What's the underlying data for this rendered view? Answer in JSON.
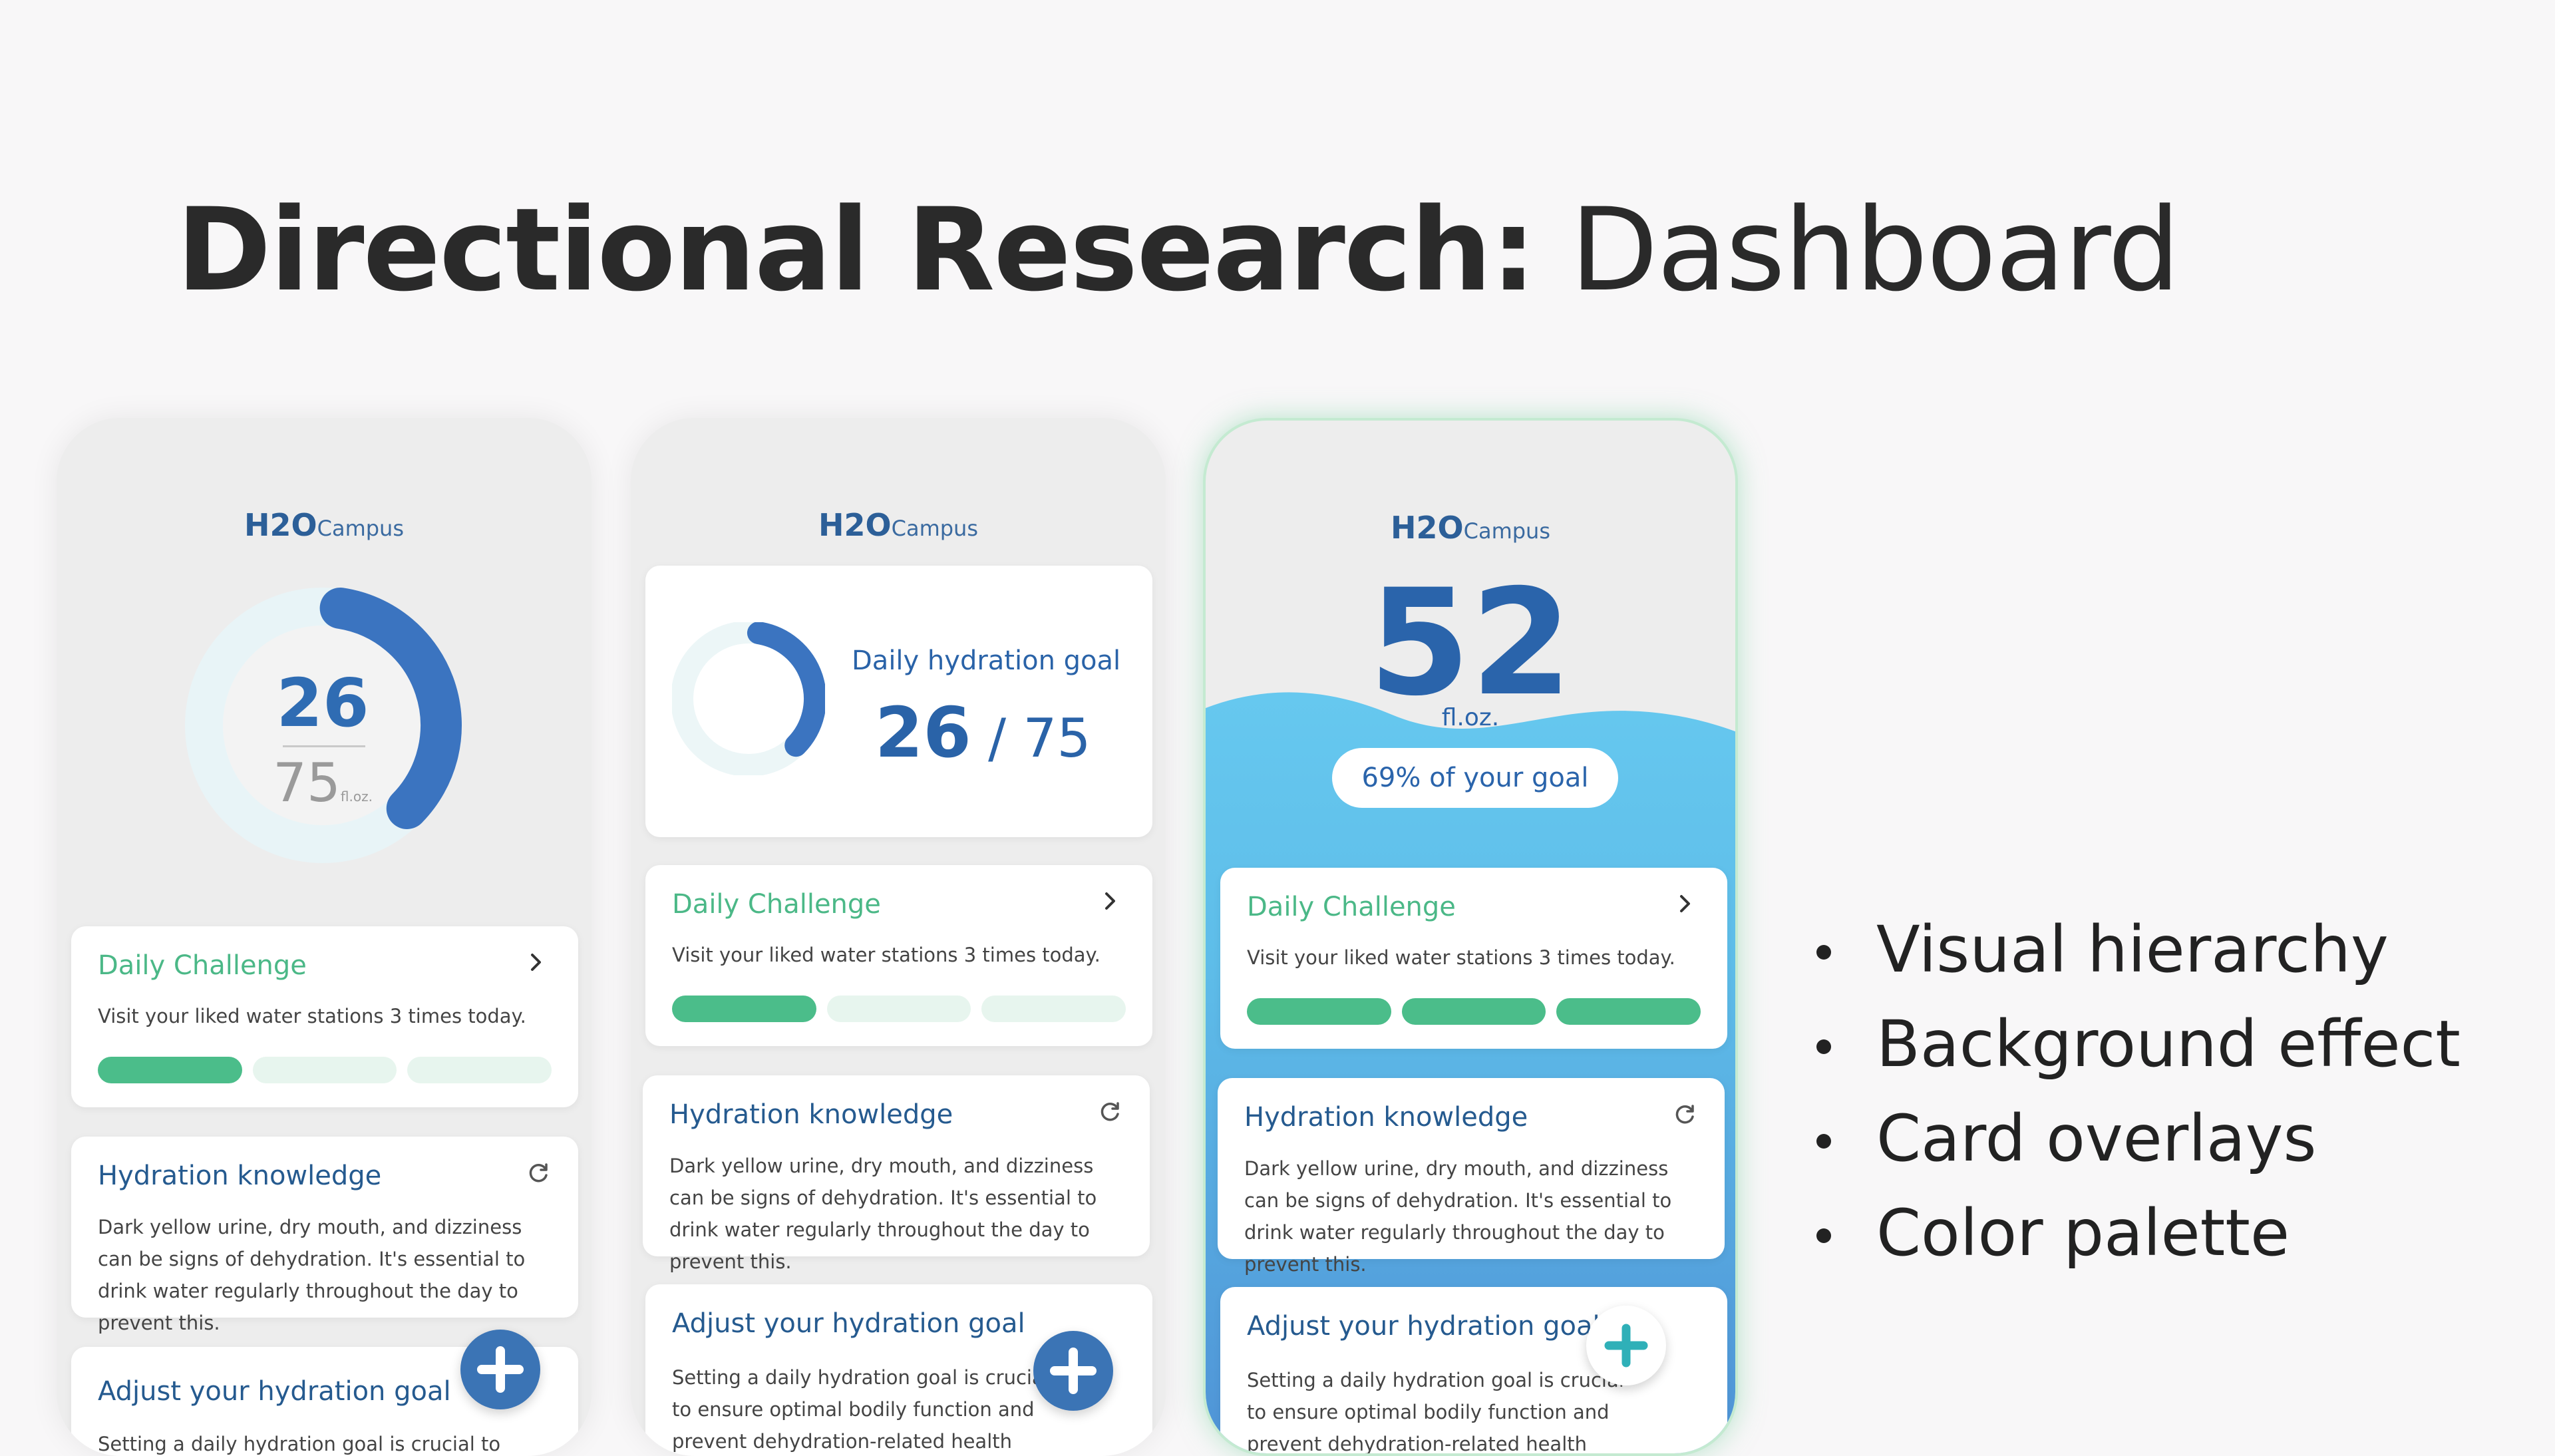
{
  "slide": {
    "title_bold": "Directional Research:",
    "title_light": " Dashboard",
    "bullets": [
      "Visual hierarchy",
      "Background effect",
      "Card overlays",
      "Color palette"
    ]
  },
  "brand": {
    "name": "H2O",
    "suffix": "Campus"
  },
  "colors": {
    "primary_blue": "#2f6cb3",
    "accent_green": "#4bbd8a",
    "wave_top": "#66c8ef",
    "wave_bottom": "#4f93d6",
    "phone_bg": "#ededed"
  },
  "phone1": {
    "current": "26",
    "goal": "75",
    "unit": "fl.oz.",
    "progress": 0.35
  },
  "phone2": {
    "goal_label": "Daily hydration goal",
    "current": "26",
    "separator": " / ",
    "goal": "75",
    "progress": 0.35
  },
  "phone3": {
    "current": "52",
    "unit": "fl.oz.",
    "percent_label": "69% of your goal"
  },
  "cards": {
    "challenge": {
      "title": "Daily Challenge",
      "text": "Visit your liked water stations 3 times today.",
      "progress_phone1": 1,
      "progress_phone2": 1,
      "progress_phone3": 3,
      "total": 3
    },
    "knowledge": {
      "title": "Hydration knowledge",
      "text": "Dark yellow urine, dry mouth, and dizziness can be signs of dehydration. It's essential to drink water regularly throughout the day to prevent this."
    },
    "adjust": {
      "title": "Adjust your hydration goal",
      "text": "Setting a daily hydration goal is crucial to ensure optimal bodily function and prevent dehydration-related health issues."
    }
  },
  "icons": {
    "chevron": "chevron-right-icon",
    "refresh": "refresh-icon",
    "add": "plus-icon"
  }
}
